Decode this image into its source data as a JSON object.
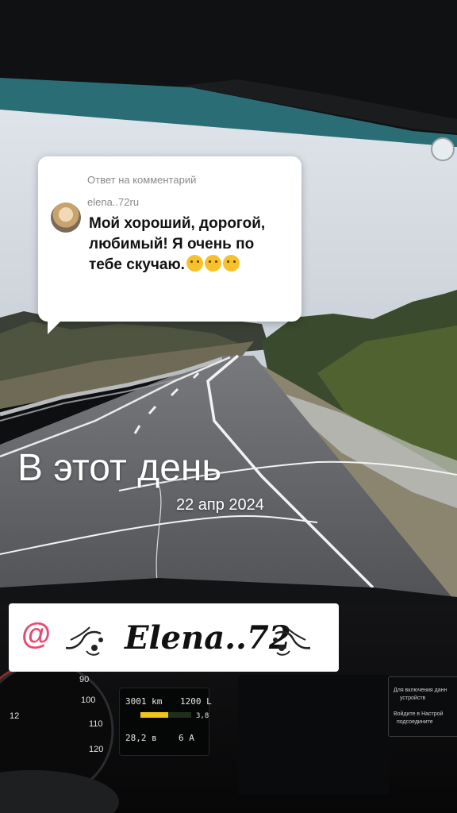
{
  "reply_card": {
    "header": "Ответ на комментарий",
    "username": "elena..72ru",
    "message": "Мой хороший, дорогой, любимый! Я очень по тебе скучаю.",
    "emoji_icons": [
      "kissing-face-icon",
      "teary-face-icon",
      "teary-face-icon"
    ]
  },
  "overlay": {
    "title": "В этот день",
    "date": "22 апр 2024"
  },
  "mention": {
    "at_symbol": "@",
    "name": "Elena..72",
    "at_color": "#e84a73"
  },
  "dashboard": {
    "odometer": "3001 km",
    "fuel_range": "1200 L",
    "fuel_level": 0.55,
    "side_value": "3,8",
    "voltage": "28,2 в",
    "current": "6 А",
    "speedometer_ticks": [
      "90",
      "100",
      "110",
      "120"
    ],
    "gear_readout": "12",
    "fuel_bar_color": "#f0c419"
  },
  "notice": {
    "line1": "Для включения данн",
    "line2": "устройств",
    "line3": "Войдите в Настрой",
    "line4": "подсоедините"
  }
}
